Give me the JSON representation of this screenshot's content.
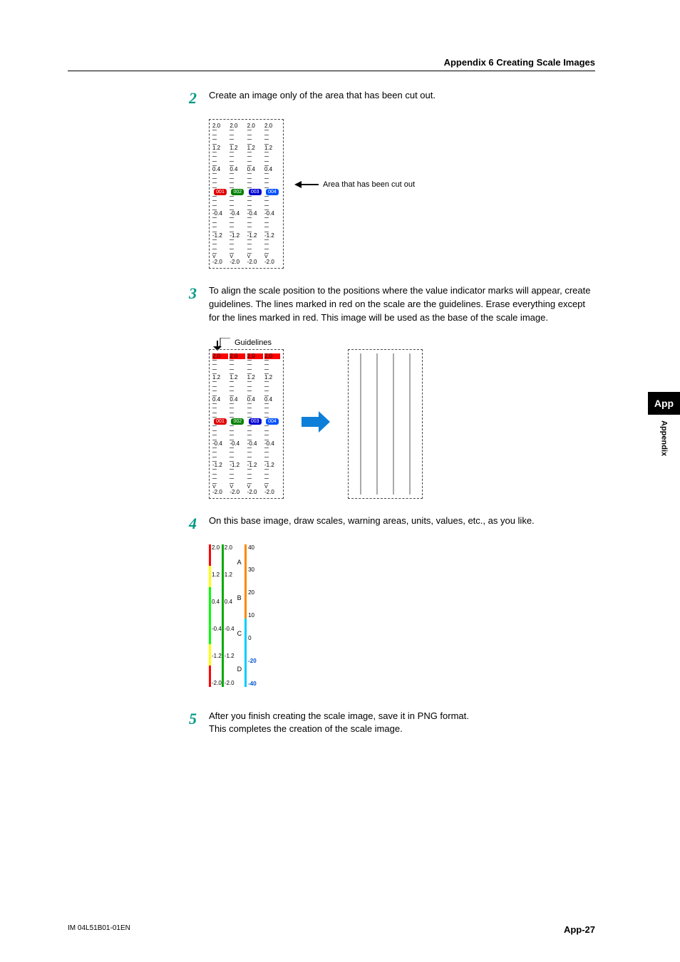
{
  "header": {
    "title": "Appendix 6 Creating Scale Images"
  },
  "sidetab": {
    "label": "App",
    "vertical": "Appendix"
  },
  "footer": {
    "doc": "IM 04L51B01-01EN",
    "page": "App-27"
  },
  "steps": {
    "s2": {
      "num": "2",
      "text": "Create an image only of the area that has been cut out."
    },
    "s3": {
      "num": "3",
      "text": "To align the scale position to the positions where the value indicator marks will appear, create guidelines. The lines marked in red on the scale are the guidelines. Erase everything except for the lines marked in red. This image will be used as the base of the scale image."
    },
    "s4": {
      "num": "4",
      "text": "On this base image, draw scales, warning areas, units, values, etc., as you like."
    },
    "s5": {
      "num": "5",
      "text": "After you finish creating the scale image, save it in PNG format.",
      "sub": "This completes the creation of the scale image."
    }
  },
  "labels": {
    "cutout": "Area that has been cut out",
    "guidelines": "Guidelines"
  },
  "scale": {
    "values_pos": [
      "2.0",
      "1.2",
      "0.4"
    ],
    "values_neg": [
      "-0.4",
      "-1.2",
      "-2.0"
    ],
    "unit": "V",
    "chans": [
      "001",
      "002",
      "003",
      "004"
    ]
  },
  "step4": {
    "letters": [
      "A",
      "B",
      "C",
      "D"
    ],
    "right_scale": [
      "40",
      "30",
      "20",
      "10",
      "0",
      "-20",
      "-40"
    ],
    "left_vals_pos": [
      "2.0",
      "1.2",
      "0.4"
    ],
    "left_vals_neg": [
      "-0.4",
      "-1.2",
      "-2.0"
    ]
  }
}
